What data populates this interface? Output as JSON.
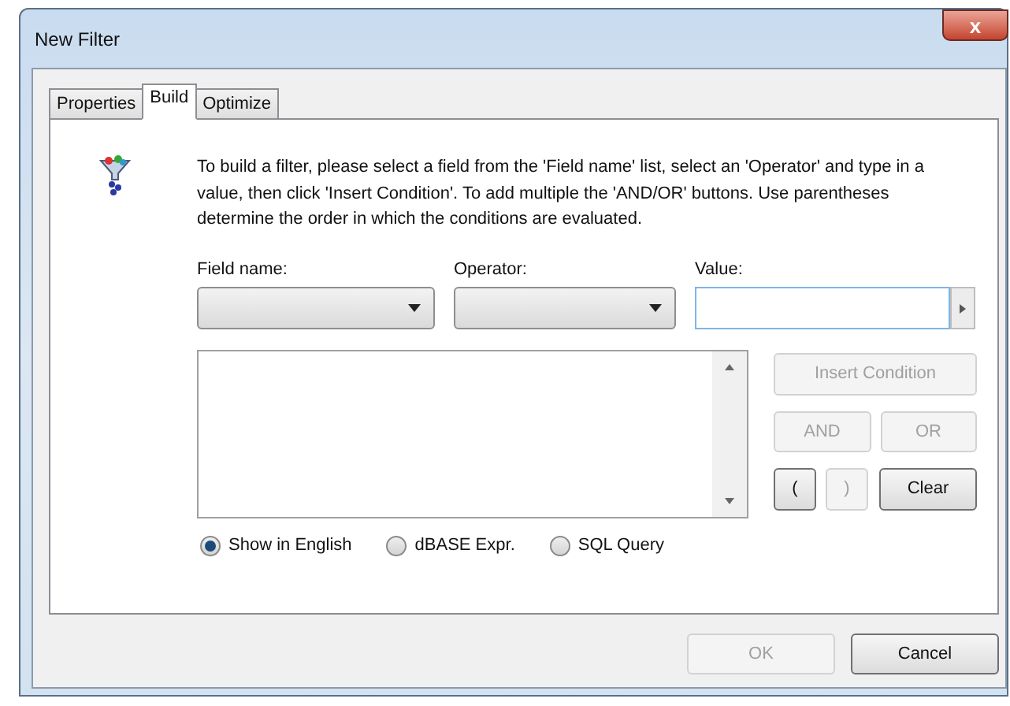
{
  "window": {
    "title": "New Filter",
    "close": "x"
  },
  "tabs": [
    {
      "label": "Properties",
      "selected": false
    },
    {
      "label": "Build",
      "selected": true
    },
    {
      "label": "Optimize",
      "selected": false
    }
  ],
  "description": "To build a filter, please select a field from the 'Field name' list, select an 'Operator'  and type in a value, then click 'Insert Condition'. To add multiple the 'AND/OR' buttons.  Use parentheses determine the order in which the conditions are evaluated.",
  "fields": [
    {
      "kind": "combo",
      "label": "Field name:"
    },
    {
      "kind": "combo",
      "label": "Operator:"
    },
    {
      "kind": "text",
      "label": "Value:"
    }
  ],
  "buttons": [
    {
      "label": "Insert Condition",
      "disabled": true
    },
    {
      "label": "AND",
      "disabled": true
    },
    {
      "label": "OR",
      "disabled": true
    },
    {
      "label": "(",
      "disabled": false
    },
    {
      "label": ")",
      "disabled": true
    },
    {
      "label": "Clear",
      "disabled": false
    }
  ],
  "display_modes": [
    {
      "label": "Show in English",
      "selected": true
    },
    {
      "label": "dBASE Expr.",
      "selected": false
    },
    {
      "label": "SQL Query",
      "selected": false
    }
  ],
  "footer_buttons": [
    {
      "label": "OK",
      "disabled": true
    },
    {
      "label": "Cancel",
      "disabled": false
    }
  ]
}
